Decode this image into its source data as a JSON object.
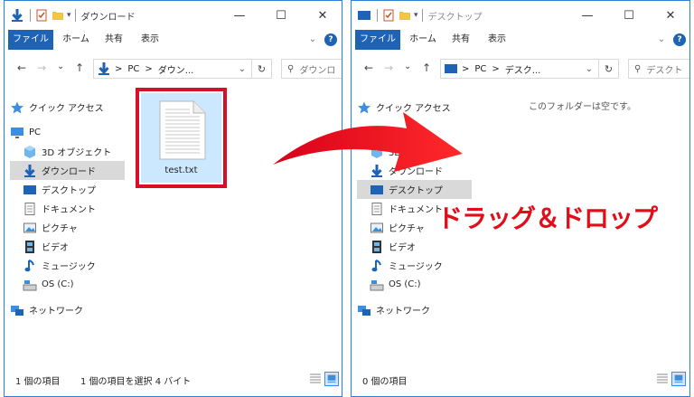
{
  "colors": {
    "accent": "#1f63b5",
    "selection": "#cce8ff",
    "highlight": "#d7102a",
    "annotation": "#e30d1a"
  },
  "left": {
    "title": "ダウンロード",
    "ribbon": {
      "file": "ファイル",
      "home": "ホーム",
      "share": "共有",
      "view": "表示"
    },
    "address": {
      "pc": "PC",
      "sep": ">",
      "current": "ダウン..."
    },
    "search_placeholder": "ダウンロ",
    "nav": {
      "quick_access": "クイック アクセス",
      "pc": "PC",
      "objects3d": "3D オブジェクト",
      "downloads": "ダウンロード",
      "desktop": "デスクトップ",
      "documents": "ドキュメント",
      "pictures": "ピクチャ",
      "videos": "ビデオ",
      "music": "ミュージック",
      "osdrive": "OS (C:)",
      "network": "ネットワーク"
    },
    "file": {
      "name": "test.txt",
      "icon": "text-file-icon"
    },
    "status": {
      "count": "1 個の項目",
      "selected": "1 個の項目を選択  4 バイト"
    }
  },
  "right": {
    "title": "デスクトップ",
    "ribbon": {
      "file": "ファイル",
      "home": "ホーム",
      "share": "共有",
      "view": "表示"
    },
    "address": {
      "pc": "PC",
      "sep": ">",
      "current": "デスク..."
    },
    "search_placeholder": "デスクト",
    "nav": {
      "quick_access": "クイック アクセス",
      "pc": "PC",
      "objects3d": "3D オブジェクト",
      "downloads": "ダウンロード",
      "desktop": "デスクトップ",
      "documents": "ドキュメント",
      "pictures": "ピクチャ",
      "videos": "ビデオ",
      "music": "ミュージック",
      "osdrive": "OS (C:)",
      "network": "ネットワーク"
    },
    "empty_message": "このフォルダーは空です。",
    "status": {
      "count": "0 個の項目"
    }
  },
  "annotation": {
    "label": "ドラッグ＆ドロップ"
  },
  "window_controls": {
    "minimize": "—",
    "maximize": "☐",
    "close": "✕"
  },
  "nav_buttons": {
    "back": "←",
    "forward": "→",
    "recent": "⌄",
    "up": "↑",
    "refresh": "↻",
    "search_icon": "⚲",
    "chevron": "⌄",
    "help": "?"
  }
}
